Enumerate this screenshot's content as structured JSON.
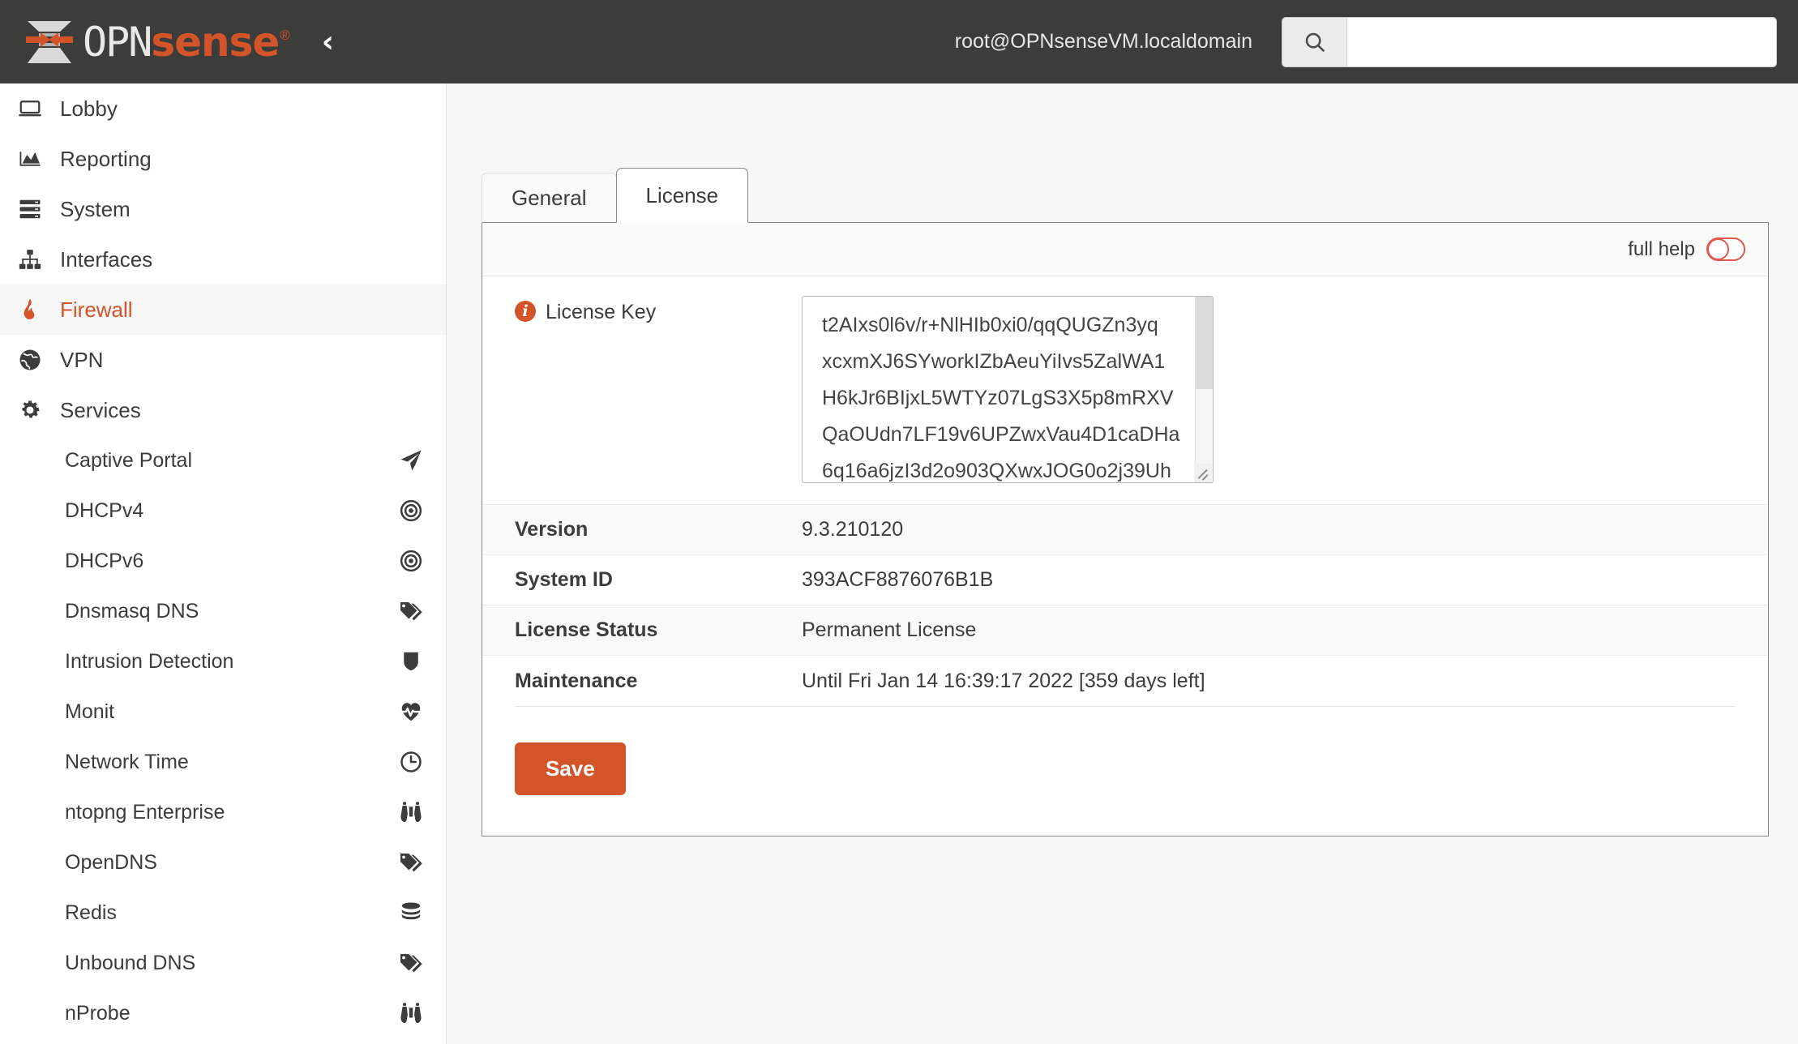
{
  "topbar": {
    "brand_opn": "OPN",
    "brand_sense": "sense",
    "brand_reg": "®",
    "collapse_glyph": "‹",
    "user": "root@OPNsenseVM.localdomain",
    "search_value": "",
    "search_placeholder": ""
  },
  "sidebar": {
    "main": [
      {
        "label": "Lobby",
        "icon": "laptop-icon",
        "active": false
      },
      {
        "label": "Reporting",
        "icon": "area-chart-icon",
        "active": false
      },
      {
        "label": "System",
        "icon": "server-icon",
        "active": false
      },
      {
        "label": "Interfaces",
        "icon": "sitemap-icon",
        "active": false
      },
      {
        "label": "Firewall",
        "icon": "fire-icon",
        "active": true
      },
      {
        "label": "VPN",
        "icon": "globe-icon",
        "active": false
      },
      {
        "label": "Services",
        "icon": "gear-icon",
        "active": false
      }
    ],
    "services": [
      {
        "label": "Captive Portal",
        "icon": "paper-plane-icon"
      },
      {
        "label": "DHCPv4",
        "icon": "bullseye-icon"
      },
      {
        "label": "DHCPv6",
        "icon": "bullseye-icon"
      },
      {
        "label": "Dnsmasq DNS",
        "icon": "tags-icon"
      },
      {
        "label": "Intrusion Detection",
        "icon": "shield-icon"
      },
      {
        "label": "Monit",
        "icon": "heartbeat-icon"
      },
      {
        "label": "Network Time",
        "icon": "clock-icon"
      },
      {
        "label": "ntopng Enterprise",
        "icon": "binoculars-icon"
      },
      {
        "label": "OpenDNS",
        "icon": "tags-icon"
      },
      {
        "label": "Redis",
        "icon": "database-icon"
      },
      {
        "label": "Unbound DNS",
        "icon": "tags-icon"
      },
      {
        "label": "nProbe",
        "icon": "binoculars-icon"
      }
    ]
  },
  "main": {
    "tabs": [
      {
        "label": "General",
        "active": false
      },
      {
        "label": "License",
        "active": true
      }
    ],
    "full_help_label": "full help",
    "license_key_label": "License Key",
    "license_key_value": "t2AIxs0l6v/r+NlHIb0xi0/qqQUGZn3yq\nxcxmXJ6SYworkIZbAeuYiIvs5ZalWA1\nH6kJr6BIjxL5WTYz07LgS3X5p8mRXV\nQaOUdn7LF19v6UPZwxVau4D1caDHa\n6q16a6jzI3d2o903QXwxJOG0o2j39Uh",
    "rows": [
      {
        "label": "Version",
        "value": "9.3.210120"
      },
      {
        "label": "System ID",
        "value": "393ACF8876076B1B"
      },
      {
        "label": "License Status",
        "value": "Permanent License"
      },
      {
        "label": "Maintenance",
        "value": "Until Fri Jan 14 16:39:17 2022 [359 days left]"
      }
    ],
    "save_label": "Save"
  },
  "colors": {
    "brand_orange": "#d4542a",
    "topbar_bg": "#3c3c3b",
    "toggle_red": "#e2574c",
    "content_bg": "#f7f7f7"
  }
}
